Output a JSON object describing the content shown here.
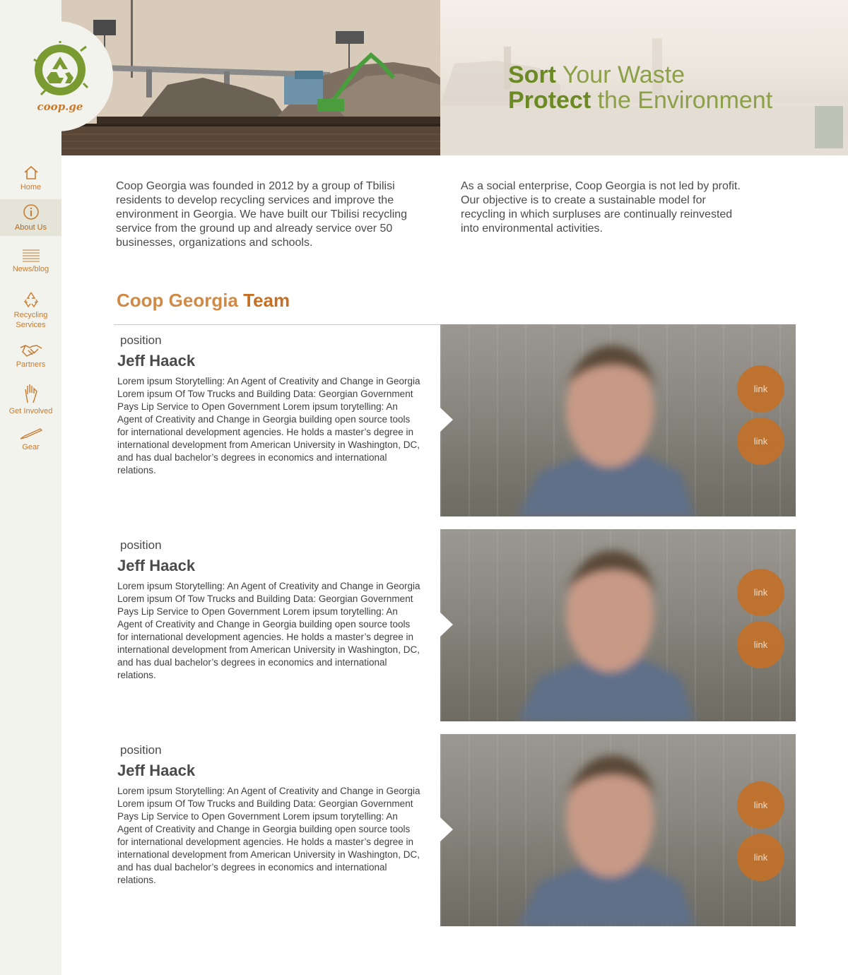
{
  "brand": {
    "name": "coop.ge",
    "logo_icon": "recycle-icon",
    "color": "#6f8b2a"
  },
  "nav": {
    "items": [
      {
        "label": "Home",
        "icon": "home-icon"
      },
      {
        "label": "About Us",
        "icon": "info-icon",
        "active": true
      },
      {
        "label": "News/blog",
        "icon": "lines-icon"
      },
      {
        "label": "Recycling Services",
        "icon": "recycle-icon"
      },
      {
        "label": "Partners",
        "icon": "handshake-icon"
      },
      {
        "label": "Get Involved",
        "icon": "hand-icon"
      },
      {
        "label": "Gear",
        "icon": "brush-icon"
      }
    ]
  },
  "hero": {
    "line1_bold": "Sort",
    "line1_rest": " Your Waste",
    "line2_bold": "Protect",
    "line2_rest": " the Environment"
  },
  "intro": {
    "left": "Coop Georgia was founded in 2012 by a group of Tbilisi residents to develop recycling services and improve the environment in Georgia. We have built our Tbilisi recycling service from the ground up and already service over 50 businesses, organizations and schools.",
    "right": "As a social enterprise, Coop Georgia is not led by profit. Our objective is to create a sustainable model for recycling in which surpluses are continually reinvested into environmental activities."
  },
  "team": {
    "heading_light": "Coop Georgia ",
    "heading_bold": "Team",
    "members": [
      {
        "position": "position",
        "name": "Jeff Haack",
        "bio": "Lorem ipsum Storytelling: An Agent of Creativity and Change in Georgia Lorem ipsum Of Tow Trucks and Building Data: Georgian Government Pays Lip Service to Open Government Lorem ipsum torytelling: An Agent of Creativity and Change in Georgia building open source tools for international development agencies. He holds a master’s degree in international development from American University in Washington, DC, and has dual bachelor’s degrees in economics and international relations.",
        "link1": "link",
        "link2": "link"
      },
      {
        "position": "position",
        "name": "Jeff Haack",
        "bio": "Lorem ipsum Storytelling: An Agent of Creativity and Change in Georgia Lorem ipsum Of Tow Trucks and Building Data: Georgian Government Pays Lip Service to Open Government Lorem ipsum torytelling: An Agent of Creativity and Change in Georgia building open source tools for international development agencies. He holds a master’s degree in international development from American University in Washington, DC, and has dual bachelor’s degrees in economics and international relations.",
        "link1": "link",
        "link2": "link"
      },
      {
        "position": "position",
        "name": "Jeff Haack",
        "bio": "Lorem ipsum Storytelling: An Agent of Creativity and Change in Georgia Lorem ipsum Of Tow Trucks and Building Data: Georgian Government Pays Lip Service to Open Government Lorem ipsum torytelling: An Agent of Creativity and Change in Georgia building open source tools for international development agencies. He holds a master’s degree in international development from American University in Washington, DC, and has dual bachelor’s degrees in economics and international relations.",
        "link1": "link",
        "link2": "link"
      }
    ]
  },
  "colors": {
    "accent": "#c97a2d",
    "green": "#6f8b2a",
    "sidebar_bg": "#f2f3ec"
  }
}
